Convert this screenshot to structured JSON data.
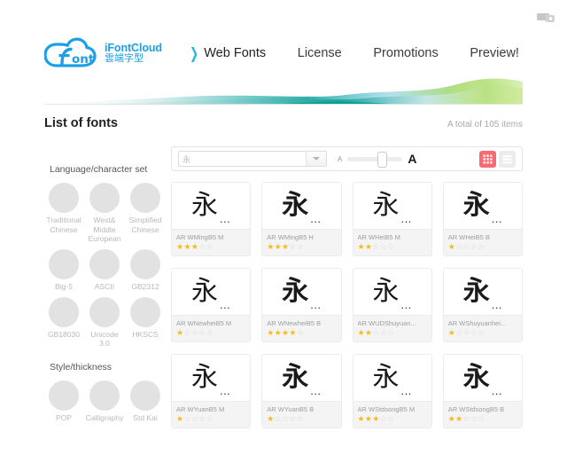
{
  "topbar": {
    "icon_name": "account-badge-icon"
  },
  "brand": {
    "name_en": "iFontCloud",
    "name_cjk": "雲端字型",
    "mark_text": "ont"
  },
  "nav": {
    "items": [
      {
        "label": "Web Fonts",
        "active": true,
        "arrow": "❯"
      },
      {
        "label": "License",
        "active": false
      },
      {
        "label": "Promotions",
        "active": false
      },
      {
        "label": "Preview!",
        "active": false
      }
    ]
  },
  "list_header": {
    "title": "List of fonts",
    "count_text": "A total of 105 items"
  },
  "toolbar": {
    "search_value": "永",
    "search_placeholder": "永",
    "dropdown_icon": "chevron-down-icon",
    "size_small_label": "A",
    "size_large_label": "A",
    "slider_position_percent": 65,
    "grid_view_label": "grid-view",
    "list_view_label": "list-view",
    "active_view": "grid",
    "accent_color": "#fa6a72"
  },
  "sidebar": {
    "groups": [
      {
        "title": "Language/character set",
        "rows": [
          [
            {
              "label": "Traditional Chinese"
            },
            {
              "label": "West& Middle European"
            },
            {
              "label": "Simplified Chinese"
            }
          ],
          [
            {
              "label": "Big-5"
            },
            {
              "label": "ASCII"
            },
            {
              "label": "GB2312"
            }
          ],
          [
            {
              "label": "GB18030"
            },
            {
              "label": "Unicode 3.0"
            },
            {
              "label": "HKSCS"
            }
          ]
        ]
      },
      {
        "title": "Style/thickness",
        "rows": [
          [
            {
              "label": "POP"
            },
            {
              "label": "Calligraphy"
            },
            {
              "label": "Std Kai"
            }
          ]
        ]
      }
    ]
  },
  "fonts": {
    "sample_glyph": "永",
    "ellipsis": "...",
    "max_stars": 5,
    "star_filled_color": "#f6bb1c",
    "star_empty_color": "#d6d6d6",
    "items": [
      {
        "name": "AR WMingB5 M",
        "stars": 3,
        "style": "serif",
        "weight": "normal"
      },
      {
        "name": "AR WMingB5 H",
        "stars": 3,
        "style": "serif",
        "weight": "bold"
      },
      {
        "name": "AR WHeiB5 M",
        "stars": 2,
        "style": "sans",
        "weight": "normal"
      },
      {
        "name": "AR WHeiB5 B",
        "stars": 1,
        "style": "sans",
        "weight": "bold"
      },
      {
        "name": "AR WNewheiB5 M",
        "stars": 1,
        "style": "sans",
        "weight": "normal"
      },
      {
        "name": "AR WNewheiB5 B",
        "stars": 4,
        "style": "sans",
        "weight": "bold"
      },
      {
        "name": "AR WUDShuyuan...",
        "stars": 2,
        "style": "sans",
        "weight": "normal"
      },
      {
        "name": "AR WShuyuanhei...",
        "stars": 1,
        "style": "sans",
        "weight": "bold"
      },
      {
        "name": "AR WYuanB5 M",
        "stars": 1,
        "style": "sans",
        "weight": "normal"
      },
      {
        "name": "AR WYuanB5 B",
        "stars": 1,
        "style": "sans",
        "weight": "bold"
      },
      {
        "name": "AR WStdsongB5 M",
        "stars": 3,
        "style": "serif",
        "weight": "normal"
      },
      {
        "name": "AR WStdsongB5 B",
        "stars": 2,
        "style": "serif",
        "weight": "bold"
      }
    ]
  }
}
